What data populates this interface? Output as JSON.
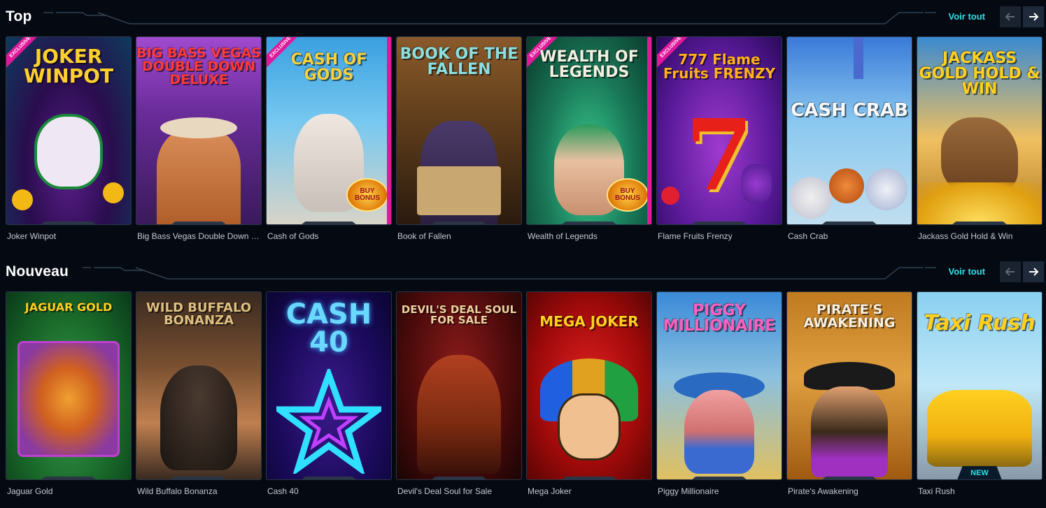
{
  "sections": {
    "top": {
      "title": "Top",
      "view_all": "Voir tout",
      "games": [
        {
          "name": "Joker Winpot",
          "art_title": "JOKER WINPOT",
          "exclusive": "EXCLUSIVE"
        },
        {
          "name": "Big Bass Vegas Double Down Del...",
          "art_title": "BIG BASS VEGAS DOUBLE DOWN DELUXE"
        },
        {
          "name": "Cash of Gods",
          "art_title": "CASH OF GODS",
          "exclusive": "EXCLUSIVE",
          "badge": "BUY BONUS"
        },
        {
          "name": "Book of Fallen",
          "art_title": "BOOK OF THE FALLEN"
        },
        {
          "name": "Wealth of Legends",
          "art_title": "WEALTH OF LEGENDS",
          "exclusive": "EXCLUSIVE",
          "badge": "BUY BONUS"
        },
        {
          "name": "Flame Fruits Frenzy",
          "art_title": "777 Flame Fruits FRENZY",
          "exclusive": "EXCLUSIVE"
        },
        {
          "name": "Cash Crab",
          "art_title": "CASH CRAB"
        },
        {
          "name": "Jackass Gold Hold & Win",
          "art_title": "JACKASS GOLD HOLD & WIN"
        }
      ]
    },
    "new": {
      "title": "Nouveau",
      "view_all": "Voir tout",
      "games": [
        {
          "name": "Jaguar Gold",
          "art_title": "JAGUAR GOLD"
        },
        {
          "name": "Wild Buffalo Bonanza",
          "art_title": "WILD BUFFALO BONANZA"
        },
        {
          "name": "Cash 40",
          "art_title": "CASH 40"
        },
        {
          "name": "Devil's Deal Soul for Sale",
          "art_title": "DEVIL'S DEAL SOUL FOR SALE"
        },
        {
          "name": "Mega Joker",
          "art_title": "MEGA JOKER"
        },
        {
          "name": "Piggy Millionaire",
          "art_title": "PIGGY MILLIONAIRE"
        },
        {
          "name": "Pirate's Awakening",
          "art_title": "PIRATE'S AWAKENING"
        },
        {
          "name": "Taxi Rush",
          "art_title": "Taxi Rush",
          "badge": "NEW"
        }
      ]
    }
  },
  "icons": {
    "prev": "arrow-left-icon",
    "next": "arrow-right-icon"
  },
  "colors": {
    "accent": "#2ee0e6",
    "background": "#050a12",
    "card_border": "#2a3646",
    "exclusive": "#e0199a"
  }
}
